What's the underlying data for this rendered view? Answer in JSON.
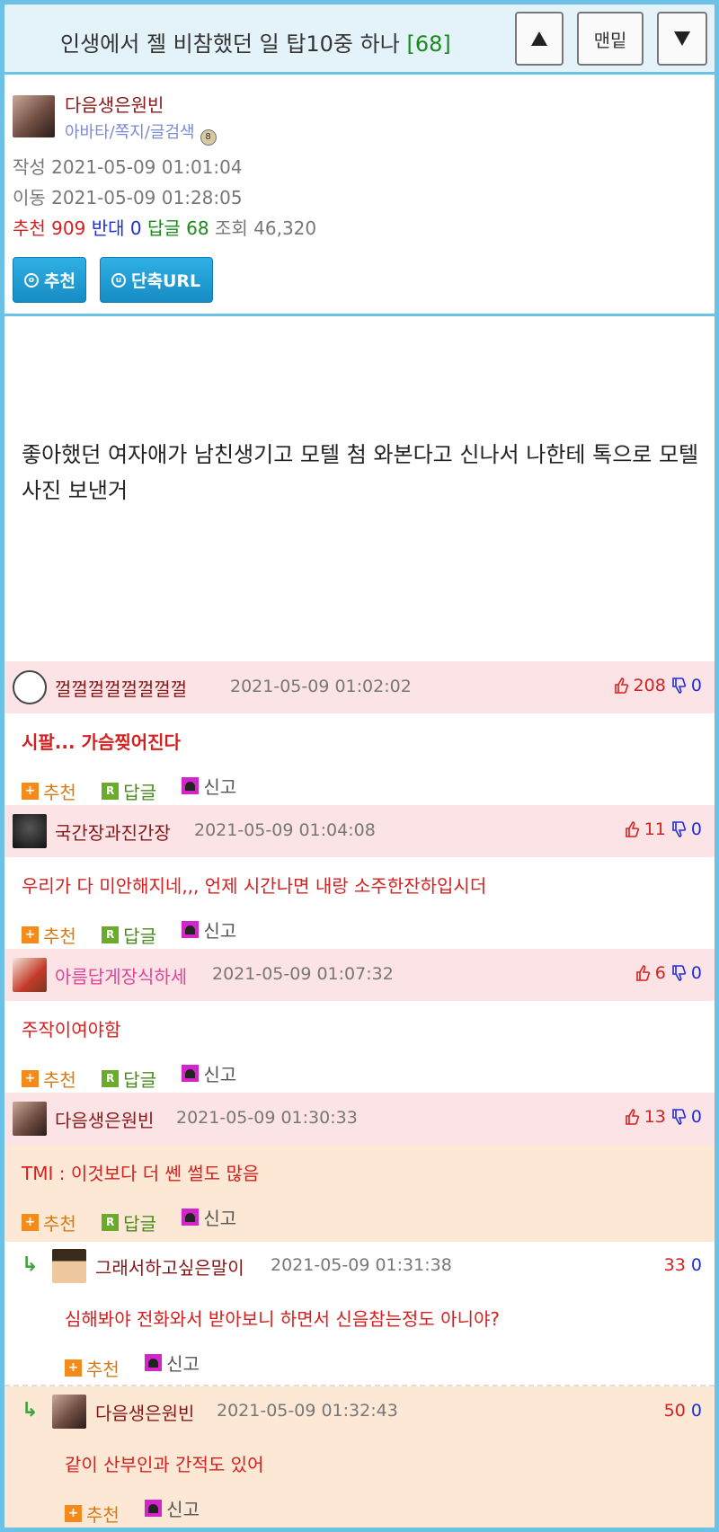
{
  "header": {
    "title": "인생에서 젤 비참했던 일 탑10중 하나",
    "comment_count": "[68]",
    "btn_up": "up",
    "btn_bottom": "맨밑",
    "btn_down": "down"
  },
  "post": {
    "author": "다음생은원빈",
    "author_links": "아바타/쪽지/글검색",
    "written_label": "작성",
    "written_date": "2021-05-09 01:01:04",
    "moved_label": "이동",
    "moved_date": "2021-05-09 01:28:05",
    "rec_label": "추천",
    "rec_value": "909",
    "against_label": "반대",
    "against_value": "0",
    "reply_label": "답글",
    "reply_value": "68",
    "views_label": "조회",
    "views_value": "46,320",
    "btn_recommend": "추천",
    "btn_shorturl": "단축URL",
    "body": "좋아했던 여자애가 남친생기고 모텔 첨 와본다고 신나서 나한테 톡으로 모텔사진 보낸거"
  },
  "actions": {
    "recommend": "추천",
    "reply": "답글",
    "report": "신고"
  },
  "comments": [
    {
      "name": "껄껄껄껄껄껄껄껄",
      "date": "2021-05-09 01:02:02",
      "up": "208",
      "down": "0",
      "text": "시팔... 가슴찢어진다"
    },
    {
      "name": "국간장과진간장",
      "date": "2021-05-09 01:04:08",
      "up": "11",
      "down": "0",
      "text": "우리가 다 미안해지네,,, 언제 시간나면 내랑 소주한잔하입시더"
    },
    {
      "name": "아름답게장식하세",
      "date": "2021-05-09 01:07:32",
      "up": "6",
      "down": "0",
      "text": "주작이여야함"
    },
    {
      "name": "다음생은원빈",
      "date": "2021-05-09 01:30:33",
      "up": "13",
      "down": "0",
      "text": "TMI : 이것보다 더 쎈 썰도 많음"
    }
  ],
  "replies": [
    {
      "name": "그래서하고싶은말이",
      "date": "2021-05-09 01:31:38",
      "up": "33",
      "down": "0",
      "text": "심해봐야 전화와서 받아보니 하면서 신음참는정도 아니야?"
    },
    {
      "name": "다음생은원빈",
      "date": "2021-05-09 01:32:43",
      "up": "50",
      "down": "0",
      "text": "같이 산부인과 간적도 있어"
    }
  ],
  "colors": {
    "border": "#6cc2e6",
    "header_bg": "#e4f2f9",
    "comment_head_bg": "#fce3e6",
    "author_reply_bg": "#fce8d4",
    "accent_red": "#d62020",
    "accent_blue": "#1d2ed6"
  }
}
